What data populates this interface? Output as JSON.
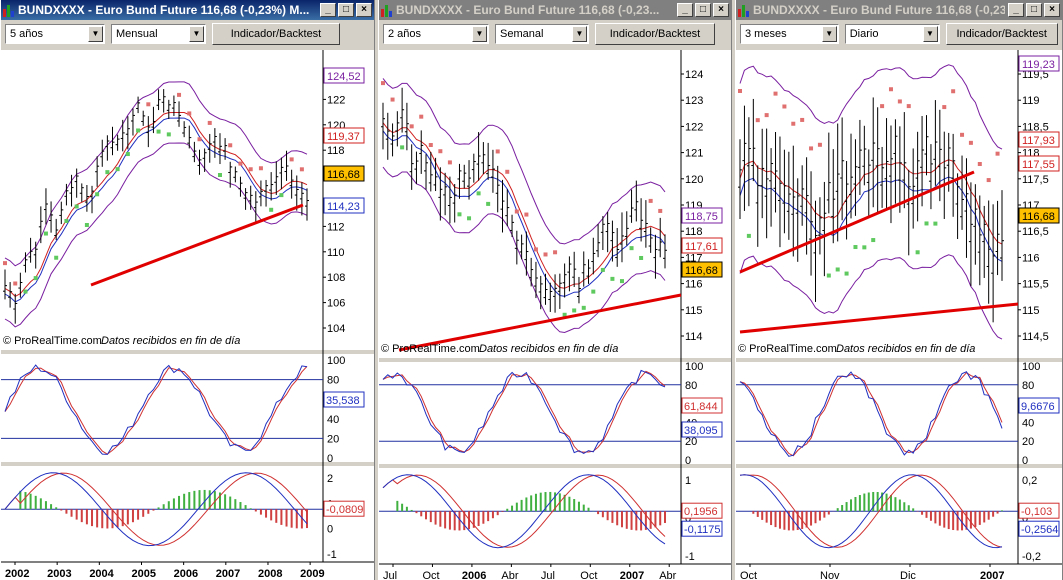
{
  "windows": [
    {
      "title": "BUNDXXXX - Euro Bund Future    116,68 (-0,23%)   M...",
      "active": true,
      "period": "5 años",
      "interval": "Mensual",
      "indicator_button": "Indicador/Backtest",
      "watermark": "© ProRealTime.com",
      "watermark_note": "Datos recibidos en fin de día",
      "price_ticks": [
        "124",
        "122",
        "120",
        "118",
        "116",
        "114",
        "112",
        "110",
        "108",
        "106",
        "104"
      ],
      "price_badges": {
        "upper": "124,52",
        "mid": "119,37",
        "current": "116,68",
        "lower": "114,23"
      },
      "stoch_ticks": [
        "100",
        "80",
        "60",
        "40",
        "20",
        "0"
      ],
      "stoch_badges": {
        "value": "35,538"
      },
      "macd_ticks": [
        "2",
        "1",
        "0",
        "-1"
      ],
      "macd_badges": {
        "value": "-0,0809"
      },
      "x_ticks": [
        "2002",
        "2003",
        "2004",
        "2005",
        "2006",
        "2007",
        "2008",
        "2009"
      ]
    },
    {
      "title": "BUNDXXXX - Euro Bund Future    116,68 (-0,23...",
      "active": false,
      "period": "2 años",
      "interval": "Semanal",
      "indicator_button": "Indicador/Backtest",
      "watermark": "© ProRealTime.com",
      "watermark_note": "Datos recibidos en fin de día",
      "price_ticks": [
        "124",
        "123",
        "122",
        "121",
        "120",
        "119",
        "118",
        "117",
        "116",
        "115",
        "114"
      ],
      "price_badges": {
        "upper": "118,75",
        "mid": "117,61",
        "current": "116,68"
      },
      "stoch_ticks": [
        "100",
        "80",
        "60",
        "40",
        "20",
        "0"
      ],
      "stoch_badges": {
        "upper": "61,844",
        "lower": "38,095"
      },
      "macd_ticks": [
        "1",
        "0",
        "-1"
      ],
      "macd_badges": {
        "upper": "0,1956",
        "lower": "-0,1175"
      },
      "x_ticks": [
        "Jul",
        "Oct",
        "2006",
        "Abr",
        "Jul",
        "Oct",
        "2007",
        "Abr"
      ]
    },
    {
      "title": "BUNDXXXX - Euro Bund Future    116,68 (-0,23...",
      "active": false,
      "period": "3 meses",
      "interval": "Diario",
      "indicator_button": "Indicador/Backtest",
      "watermark": "© ProRealTime.com",
      "watermark_note": "Datos recibidos en fin de día",
      "price_ticks": [
        "119,5",
        "119",
        "118,5",
        "118",
        "117,5",
        "117",
        "116,5",
        "116",
        "115,5",
        "115",
        "114,5"
      ],
      "price_badges": {
        "upper": "119,23",
        "mid": "117,93",
        "mid2": "117,55",
        "current": "116,68"
      },
      "stoch_ticks": [
        "100",
        "80",
        "60",
        "40",
        "20",
        "0"
      ],
      "stoch_badges": {
        "value": "9,6676"
      },
      "macd_ticks": [
        "0,2",
        "0",
        "-0,2"
      ],
      "macd_badges": {
        "upper": "-0,103",
        "lower": "-0,2564"
      },
      "x_ticks": [
        "Oct",
        "Nov",
        "Dic",
        "2007"
      ]
    }
  ],
  "colors": {
    "bars": "#000000",
    "sar_up": "#5ec95e",
    "sar_down": "#e07070",
    "bollinger": "#7a1fa0",
    "ma": "#d02020",
    "trendline": "#e00000",
    "stoch_k": "#2030c0",
    "stoch_d": "#d03030",
    "level_line": "#2030a0",
    "hist_pos": "#40b040",
    "hist_neg": "#d04040",
    "current_badge": "#ffc000"
  }
}
